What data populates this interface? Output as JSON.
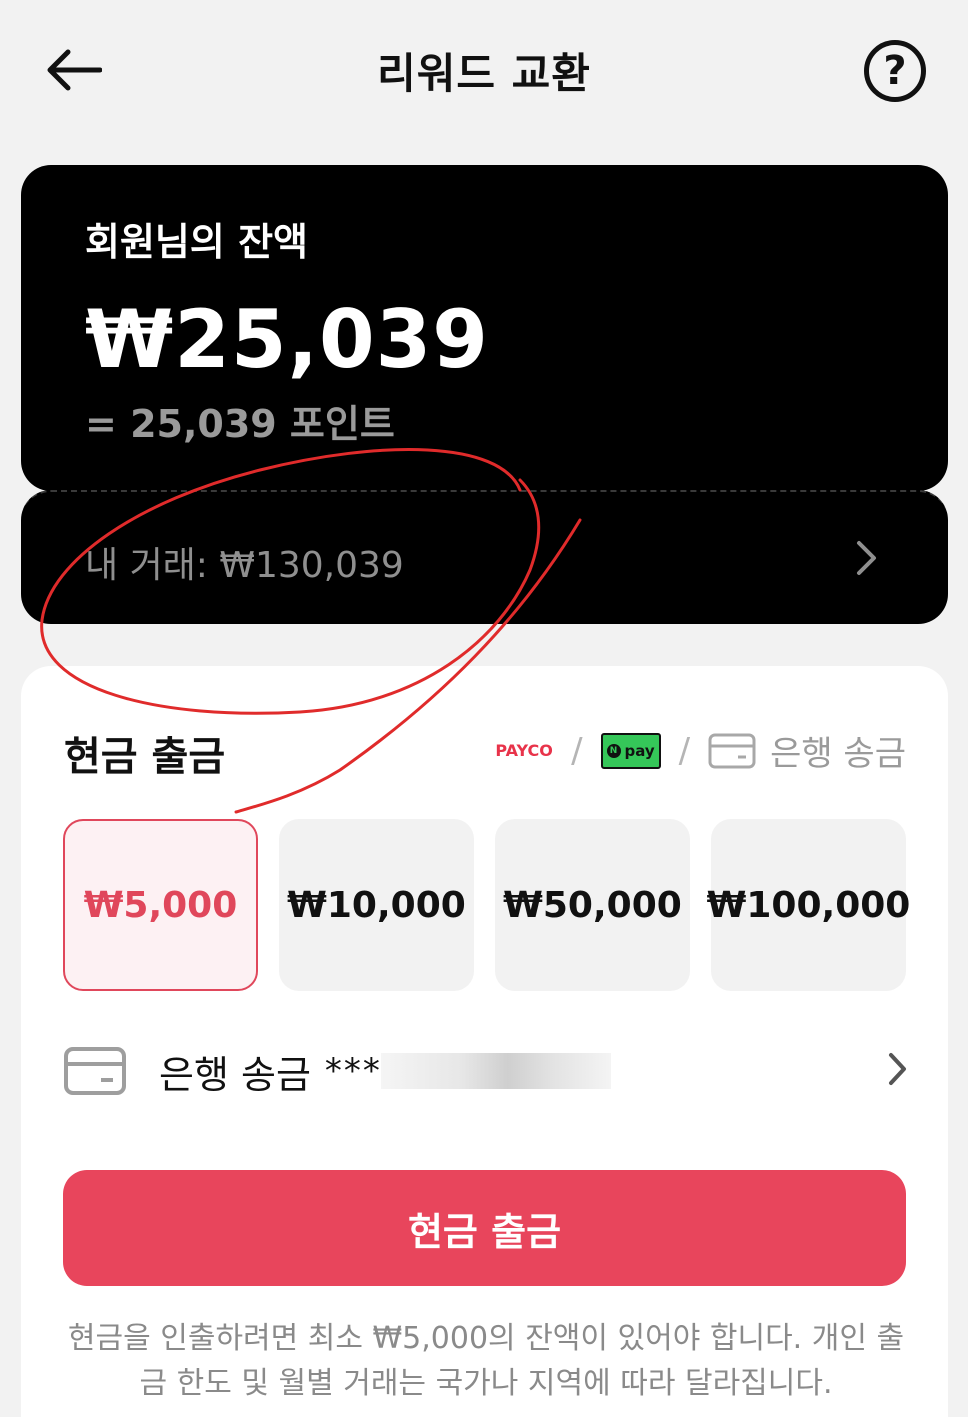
{
  "header": {
    "title": "리워드 교환",
    "back_icon": "arrow-left-icon",
    "help_label": "?"
  },
  "balance": {
    "label": "회원님의 잔액",
    "amount": "₩25,039",
    "points": "= 25,039 포인트"
  },
  "transactions": {
    "label": "내 거래: ₩130,039"
  },
  "cash_out": {
    "title": "현금 출금",
    "methods": {
      "payco": "PAYCO",
      "npay": "pay",
      "npay_n": "N",
      "separator": "/",
      "bank": "은행 송금"
    },
    "amounts": [
      {
        "label": "₩5,000",
        "selected": true
      },
      {
        "label": "₩10,000",
        "selected": false
      },
      {
        "label": "₩50,000",
        "selected": false
      },
      {
        "label": "₩100,000",
        "selected": false
      }
    ],
    "bank_row": {
      "label": "은행 송금",
      "masked": "****"
    },
    "button_label": "현금 출금",
    "notice": "현금을 인출하려면 최소 ₩5,000의 잔액이 있어야 합니다. 개인 출금 한도 및 월별 거래는 국가나 지역에 따라 달라집니다."
  },
  "colors": {
    "accent": "#e8455c",
    "card_bg": "#000000",
    "annotation": "#e02b2b"
  }
}
